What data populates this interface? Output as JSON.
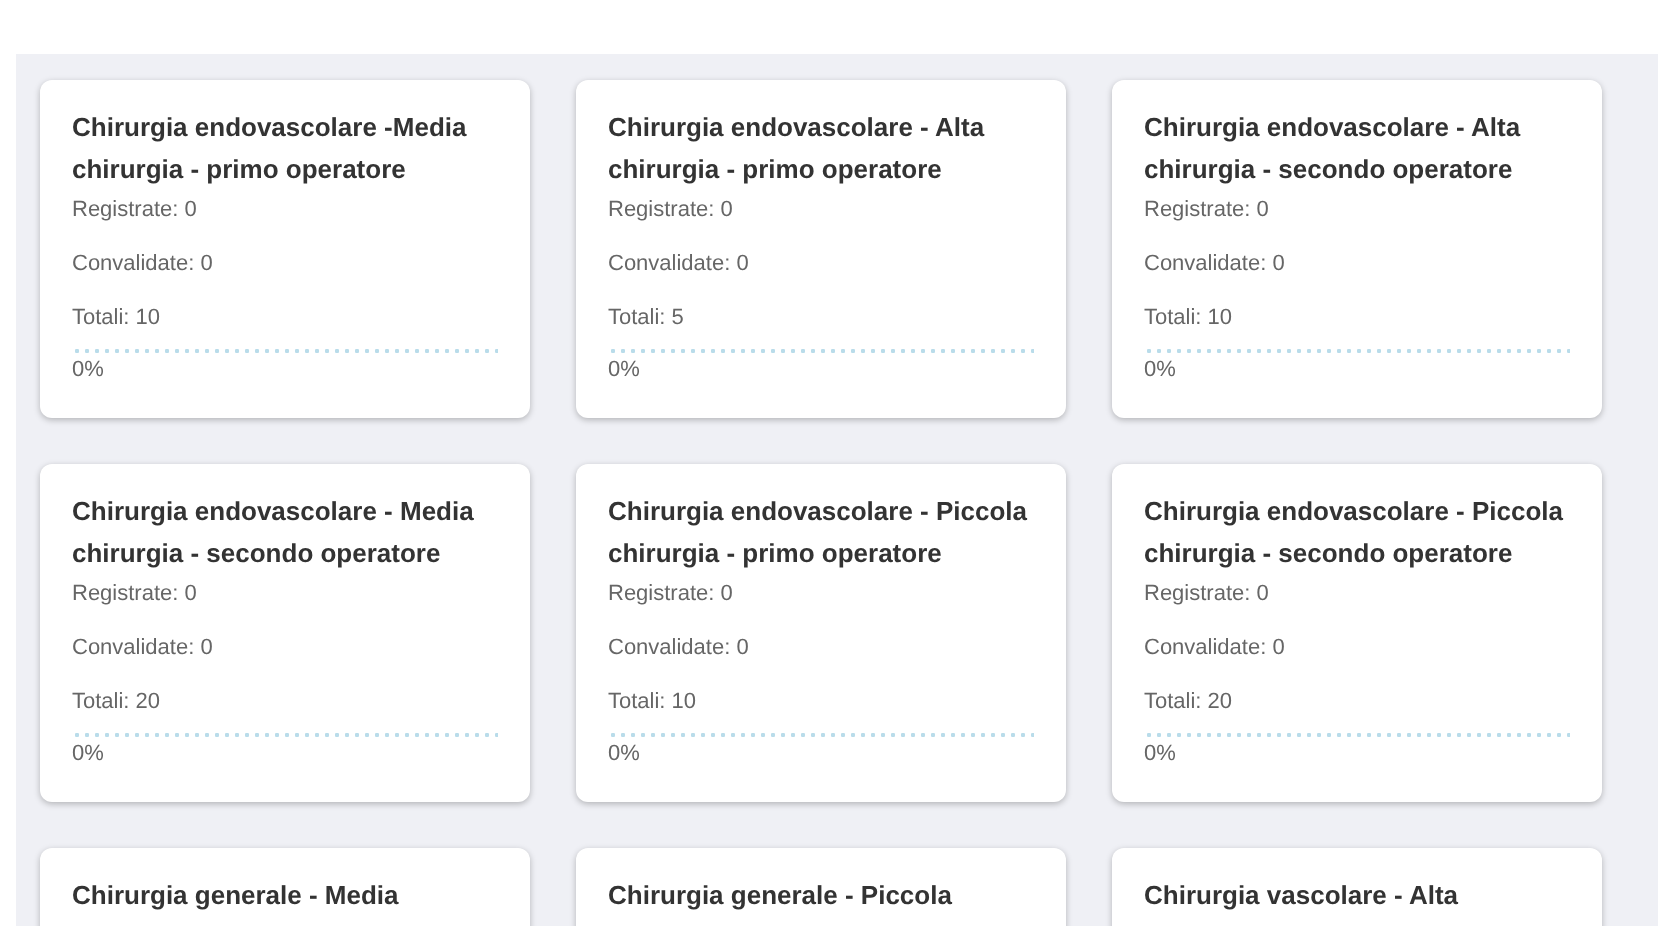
{
  "cards": [
    {
      "title": "Chirurgia endovascolare -Media chirurgia - primo operatore",
      "registered": "Registrate: 0",
      "validated": "Convalidate: 0",
      "total": "Totali: 10",
      "level": 0,
      "percent": "0%"
    },
    {
      "title": "Chirurgia endovascolare - Alta chirurgia - primo operatore",
      "registered": "Registrate: 0",
      "validated": "Convalidate: 0",
      "total": "Totali: 5",
      "level": 0,
      "percent": "0%"
    },
    {
      "title": "Chirurgia endovascolare - Alta chirurgia - secondo operatore",
      "registered": "Registrate: 0",
      "validated": "Convalidate: 0",
      "total": "Totali: 10",
      "level": 0,
      "percent": "0%"
    },
    {
      "title": "Chirurgia endovascolare - Media chirurgia - secondo operatore",
      "registered": "Registrate: 0",
      "validated": "Convalidate: 0",
      "total": "Totali: 20",
      "level": 0,
      "percent": "0%"
    },
    {
      "title": "Chirurgia endovascolare - Piccola chirurgia - primo operatore",
      "registered": "Registrate: 0",
      "validated": "Convalidate: 0",
      "total": "Totali: 10",
      "level": 0,
      "percent": "0%"
    },
    {
      "title": "Chirurgia endovascolare - Piccola chirurgia - secondo operatore",
      "registered": "Registrate: 0",
      "validated": "Convalidate: 0",
      "total": "Totali: 20",
      "level": 0,
      "percent": "0%"
    },
    {
      "title": "Chirurgia generale - Media"
    },
    {
      "title": "Chirurgia generale - Piccola"
    },
    {
      "title": "Chirurgia vascolare - Alta"
    }
  ]
}
